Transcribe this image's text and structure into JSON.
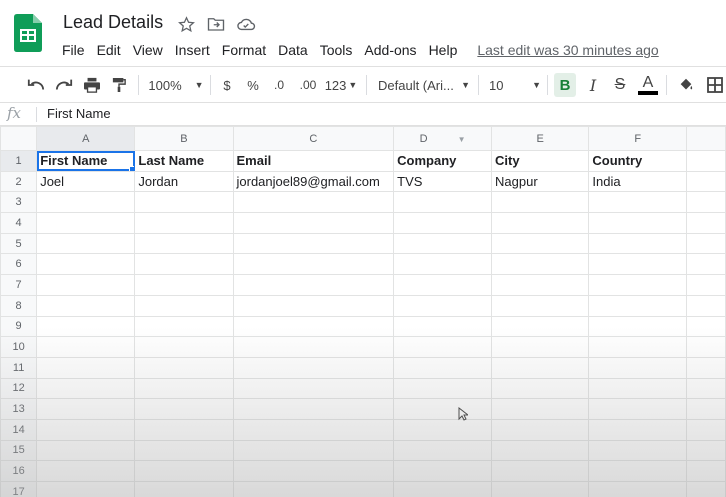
{
  "app": {
    "title": "Lead Details",
    "menu": [
      "File",
      "Edit",
      "View",
      "Insert",
      "Format",
      "Data",
      "Tools",
      "Add-ons",
      "Help"
    ],
    "last_edit": "Last edit was 30 minutes ago",
    "brand_color": "#0f9d58"
  },
  "toolbar": {
    "zoom": "100%",
    "currency": "$",
    "percent": "%",
    "decrease_decimals": ".0",
    "increase_decimals": ".00",
    "more_formats": "123",
    "font": "Default (Ari...",
    "font_size": "10",
    "bold": "B",
    "italic": "I",
    "strike": "S",
    "text_color": "A"
  },
  "formula_bar": {
    "fx": "fx",
    "content": "First Name"
  },
  "sheet": {
    "columns": [
      "A",
      "B",
      "C",
      "D",
      "E",
      "F"
    ],
    "row_numbers": [
      "1",
      "2",
      "3",
      "4",
      "5",
      "6",
      "7",
      "8",
      "9",
      "10",
      "11",
      "12",
      "13",
      "14",
      "15",
      "16",
      "17"
    ],
    "header_row": [
      "First Name",
      "Last Name",
      "Email",
      "Company",
      "City",
      "Country"
    ],
    "data_row": [
      "Joel",
      "Jordan",
      "jordanjoel89@gmail.com",
      "TVS",
      "Nagpur",
      "India"
    ],
    "selected_cell": "A1"
  }
}
